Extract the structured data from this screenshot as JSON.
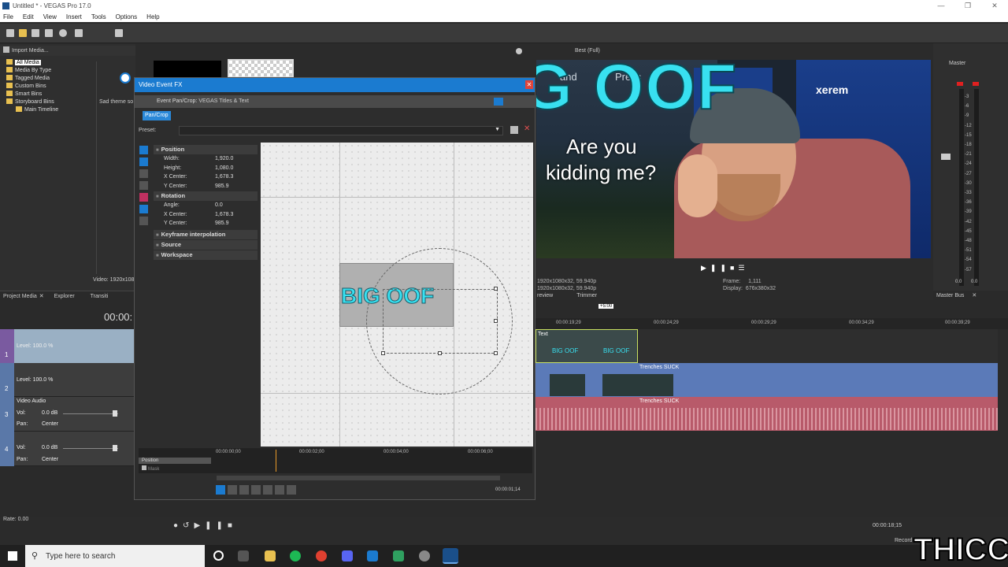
{
  "window": {
    "title": "Untitled * - VEGAS Pro 17.0"
  },
  "menu": [
    "File",
    "Edit",
    "View",
    "Insert",
    "Tools",
    "Options",
    "Help"
  ],
  "explorer": {
    "toolbar_label": "Import Media...",
    "tree": [
      "All Media",
      "Media By Type",
      "Tagged Media",
      "Custom Bins",
      "Smart Bins",
      "Storyboard Bins",
      "Main Timeline"
    ],
    "thumb_caption": "Sad theme so",
    "video_info": "Video: 1920x108",
    "tabs": [
      "Project Media",
      "Explorer",
      "Transiti"
    ]
  },
  "fx": {
    "title": "Video Event FX",
    "chain_label": "Event Pan/Crop:",
    "chain_plugin": "VEGAS Titles & Text",
    "panchip": "Pan/Crop",
    "preset_label": "Preset:",
    "position": {
      "section": "Position",
      "rows": [
        {
          "label": "Width:",
          "value": "1,920.0"
        },
        {
          "label": "Height:",
          "value": "1,080.0"
        },
        {
          "label": "X Center:",
          "value": "1,678.3"
        },
        {
          "label": "Y Center:",
          "value": "985.9"
        }
      ]
    },
    "rotation": {
      "section": "Rotation",
      "rows": [
        {
          "label": "Angle:",
          "value": "0.0"
        },
        {
          "label": "X Center:",
          "value": "1,678.3"
        },
        {
          "label": "Y Center:",
          "value": "985.9"
        }
      ]
    },
    "other_sections": [
      "Keyframe interpolation",
      "Source",
      "Workspace"
    ],
    "canvas_text": "BIG OOF",
    "keyframe_times": [
      "00:00:00;00",
      "00:00:02;00",
      "00:00:04;00",
      "00:00:06;00"
    ],
    "lanes": [
      "Position",
      "Mask"
    ],
    "timecode": "00:00:01;14"
  },
  "preview": {
    "toolbar_quality": "Best (Full)",
    "big_text": "G OOF",
    "sub_text_1": "Are you",
    "sub_text_2": "kidding me?",
    "bg_text_1": "and",
    "bg_text_2": "Press",
    "chair_text": "xerem",
    "project_info_1": "1920x1080x32, 59.940p",
    "project_info_2": "1920x1080x32, 59.940p",
    "frame_label": "Frame:",
    "frame_value": "1,111",
    "display_label": "Display:",
    "display_value": "676x380x32",
    "tabs": [
      "review",
      "Trimmer"
    ]
  },
  "master": {
    "title": "Master",
    "scale": [
      "3",
      "6",
      "9",
      "12",
      "15",
      "18",
      "21",
      "24",
      "27",
      "30",
      "33",
      "36",
      "39",
      "42",
      "45",
      "48",
      "51",
      "54",
      "57"
    ],
    "bottom_label": "Master Bus",
    "peak_left": "0.0",
    "peak_right": "0.0"
  },
  "timeline": {
    "cursor_time": "00:00:",
    "ruler": [
      "00:00:19;29",
      "00:00:24;29",
      "00:00:29;29",
      "00:00:34;29",
      "00:00:39;29"
    ],
    "marker_time": "+5:00",
    "tracks": [
      {
        "level": "Level: 100.0 %",
        "num": "1"
      },
      {
        "level": "Level: 100.0 %",
        "num": "2"
      },
      {
        "name": "Video Audio",
        "vol_label": "Vol:",
        "vol": "0.0 dB",
        "pan_label": "Pan:",
        "pan": "Center",
        "num": "3"
      },
      {
        "vol_label": "Vol:",
        "vol": "0.0 dB",
        "pan_label": "Pan:",
        "pan": "Center",
        "num": "4"
      }
    ],
    "clip_text": "Text",
    "clip_thumb_text": "BIG OOF",
    "clip_name": "Trenches SUCK",
    "rate": "Rate: 0.00",
    "end_time": "00:00:18;15",
    "record": "Record"
  },
  "taskbar": {
    "search_placeholder": "Type here to search"
  },
  "watermark": "THICC",
  "colors": {
    "accent": "#1b7bd0",
    "video_track": "#5b7ab8",
    "audio_track": "#b85a6a",
    "cyan": "#38e0f0"
  }
}
